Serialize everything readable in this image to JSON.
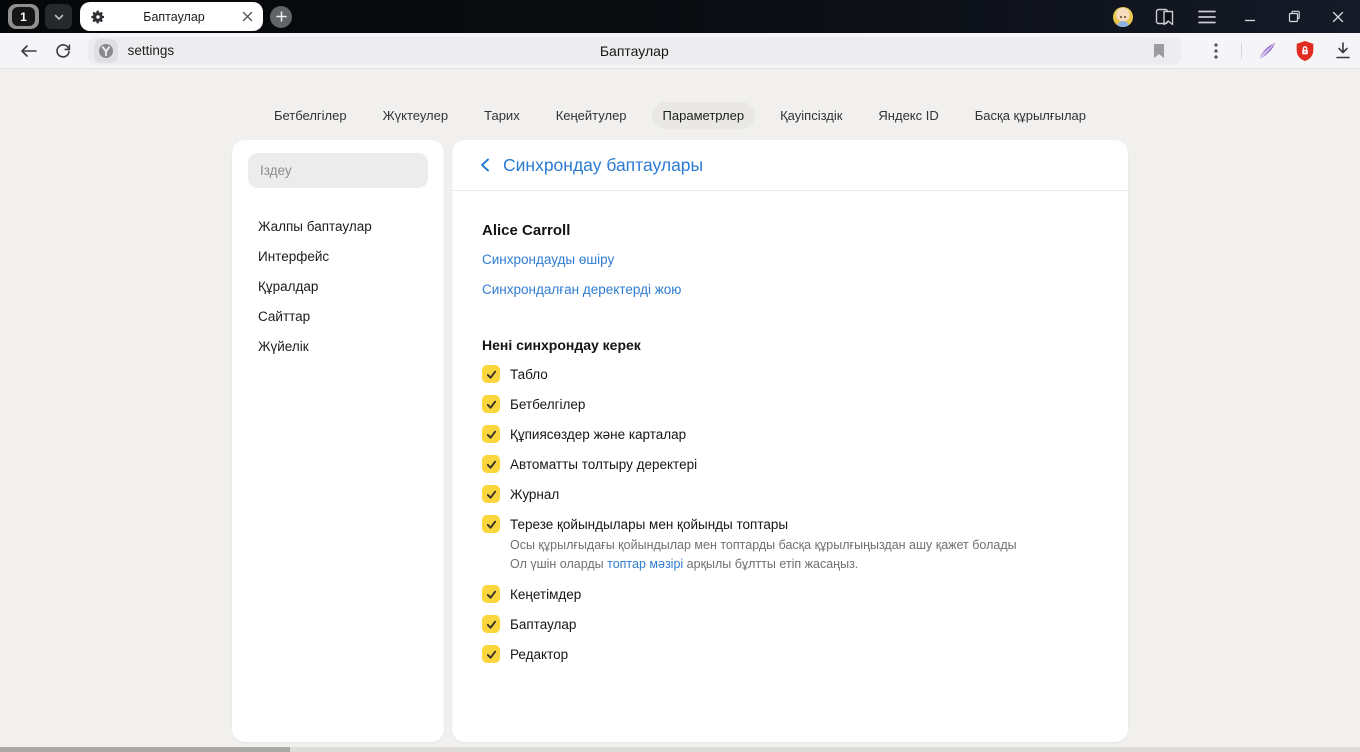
{
  "window": {
    "tab_count": "1",
    "tab_title": "Баптаулар",
    "page_title": "Баптаулар",
    "address": "settings"
  },
  "nav": {
    "items": [
      {
        "label": "Бетбелгілер",
        "active": false
      },
      {
        "label": "Жүктеулер",
        "active": false
      },
      {
        "label": "Тарих",
        "active": false
      },
      {
        "label": "Кеңейтулер",
        "active": false
      },
      {
        "label": "Параметрлер",
        "active": true
      },
      {
        "label": "Қауіпсіздік",
        "active": false
      },
      {
        "label": "Яндекс ID",
        "active": false
      },
      {
        "label": "Басқа құрылғылар",
        "active": false
      }
    ]
  },
  "sidebar": {
    "search_placeholder": "Іздеу",
    "items": [
      "Жалпы баптаулар",
      "Интерфейс",
      "Құралдар",
      "Сайттар",
      "Жүйелік"
    ]
  },
  "main": {
    "header_title": "Синхрондау баптаулары",
    "user_name": "Alice Carroll",
    "links": [
      "Синхрондауды өшіру",
      "Синхрондалған деректерді жою"
    ],
    "section_title": "Нені синхрондау керек",
    "checkboxes": [
      {
        "label": "Табло",
        "checked": true
      },
      {
        "label": "Бетбелгілер",
        "checked": true
      },
      {
        "label": "Құпиясөздер және карталар",
        "checked": true
      },
      {
        "label": "Автоматты толтыру деректері",
        "checked": true
      },
      {
        "label": "Журнал",
        "checked": true
      },
      {
        "label": "Терезе қойындылары мен қойынды топтары",
        "checked": true,
        "description_line1": "Осы құрылғыдағы қойындылар мен топтарды басқа құрылғыңыздан ашу қажет болады",
        "description_line2_prefix": "Ол үшін оларды ",
        "description_link": "топтар мәзірі",
        "description_line2_suffix": " арқылы бұлтты етіп жасаңыз."
      },
      {
        "label": "Кеңетімдер",
        "checked": true
      },
      {
        "label": "Баптаулар",
        "checked": true
      },
      {
        "label": "Редактор",
        "checked": true
      }
    ]
  },
  "colors": {
    "accent_blue": "#2b7bd3",
    "checkbox_yellow": "#fbd63d",
    "shield_red": "#e22b20",
    "feather_purple": "#9a6fd0",
    "titlebar_dark": "#0a0c10",
    "toolbar_bg": "#f5f5f7",
    "page_bg": "#f1f0ee"
  }
}
